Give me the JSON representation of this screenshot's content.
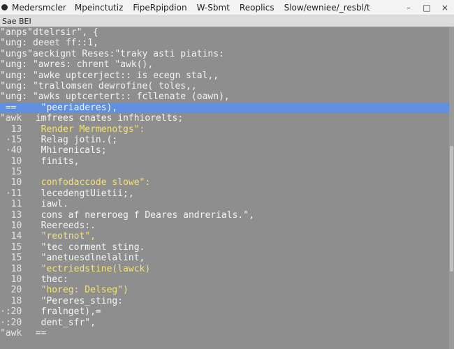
{
  "titlebar": {
    "menu": [
      "Medersmcler",
      "Mpeinctutiz",
      "FipeRpipdion",
      "W-Sbmt",
      "Reoplics",
      "Slow/ewniee/_resbl/t"
    ],
    "controls": [
      "–",
      "□",
      "×"
    ]
  },
  "subbar": {
    "label": "Sae BEI"
  },
  "top_lines": [
    "\"anps\"dtelrsir\", {",
    "\"ung: deeet ff::1,",
    "\"ungs\"aeckignt Reses:\"traky asti piatins:",
    "\"ung: \"awres: chrent \"awk(),",
    "\"ung: \"awke uptcerject:: is ecegn stal,,",
    "\"ung: \"trallomsen dewrofine( toles,,",
    "\"ung: \"awks uptcertert:: fcllenate (oawn),"
  ],
  "highlight_line": {
    "gutter": " ==",
    "content": "  \"peeriaderes),"
  },
  "awk_header": {
    "gutter": "\"awk",
    "content": " imfrees cnates infhiorelts;"
  },
  "numbered_lines": [
    {
      "gutter": "  13",
      "content": "  Render Mermenotgs\":",
      "color": "yellow"
    },
    {
      "gutter": " ·15",
      "content": "  Relag jotin.(;",
      "color": "light"
    },
    {
      "gutter": " ·40",
      "content": "  Mhirenicals;",
      "color": "light"
    },
    {
      "gutter": "  10",
      "content": "  finits,",
      "color": "light"
    },
    {
      "gutter": "  15",
      "content": "",
      "color": "light"
    },
    {
      "gutter": "  10",
      "content": "  confodaccode slowe\":",
      "color": "yellow"
    },
    {
      "gutter": " ·11",
      "content": "  lecedengtUietii;,",
      "color": "light"
    },
    {
      "gutter": "  11",
      "content": "  iawl.",
      "color": "light"
    },
    {
      "gutter": "  13",
      "content": "  cons af nereroeg f Deares andrerials.\",",
      "color": "light"
    },
    {
      "gutter": "  10",
      "content": "  Reereeds:.",
      "color": "light"
    },
    {
      "gutter": "  14",
      "content": "  \"reotnot\",",
      "color": "yellow"
    },
    {
      "gutter": "  15",
      "content": "  \"tec corment sting.",
      "color": "light"
    },
    {
      "gutter": "  15",
      "content": "  \"anetuesdlnelalint,",
      "color": "light"
    },
    {
      "gutter": "  18",
      "content": "  \"ectriedstine(lawck)",
      "color": "yellow"
    },
    {
      "gutter": "  10",
      "content": "  thec:",
      "color": "light"
    },
    {
      "gutter": "  20",
      "content": "  \"horeg: Delseg\")",
      "color": "yellow"
    },
    {
      "gutter": "  18",
      "content": "  \"Pereres_sting:",
      "color": "light"
    },
    {
      "gutter": "·:20",
      "content": "  fralnget),=",
      "color": "light"
    },
    {
      "gutter": "·:20",
      "content": "  dent_sfr\",",
      "color": "light"
    }
  ],
  "last_line": {
    "gutter": "\"awk",
    "content": " =="
  }
}
